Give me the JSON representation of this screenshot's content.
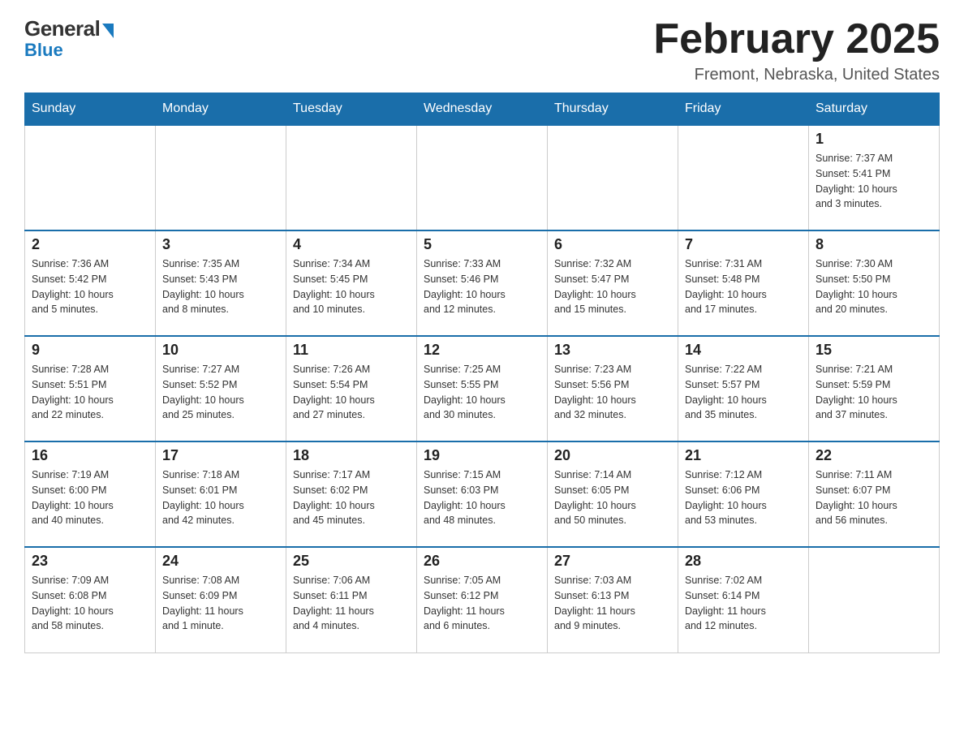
{
  "logo": {
    "general": "General",
    "blue": "Blue"
  },
  "title": "February 2025",
  "location": "Fremont, Nebraska, United States",
  "days_of_week": [
    "Sunday",
    "Monday",
    "Tuesday",
    "Wednesday",
    "Thursday",
    "Friday",
    "Saturday"
  ],
  "weeks": [
    [
      {
        "day": "",
        "info": ""
      },
      {
        "day": "",
        "info": ""
      },
      {
        "day": "",
        "info": ""
      },
      {
        "day": "",
        "info": ""
      },
      {
        "day": "",
        "info": ""
      },
      {
        "day": "",
        "info": ""
      },
      {
        "day": "1",
        "info": "Sunrise: 7:37 AM\nSunset: 5:41 PM\nDaylight: 10 hours\nand 3 minutes."
      }
    ],
    [
      {
        "day": "2",
        "info": "Sunrise: 7:36 AM\nSunset: 5:42 PM\nDaylight: 10 hours\nand 5 minutes."
      },
      {
        "day": "3",
        "info": "Sunrise: 7:35 AM\nSunset: 5:43 PM\nDaylight: 10 hours\nand 8 minutes."
      },
      {
        "day": "4",
        "info": "Sunrise: 7:34 AM\nSunset: 5:45 PM\nDaylight: 10 hours\nand 10 minutes."
      },
      {
        "day": "5",
        "info": "Sunrise: 7:33 AM\nSunset: 5:46 PM\nDaylight: 10 hours\nand 12 minutes."
      },
      {
        "day": "6",
        "info": "Sunrise: 7:32 AM\nSunset: 5:47 PM\nDaylight: 10 hours\nand 15 minutes."
      },
      {
        "day": "7",
        "info": "Sunrise: 7:31 AM\nSunset: 5:48 PM\nDaylight: 10 hours\nand 17 minutes."
      },
      {
        "day": "8",
        "info": "Sunrise: 7:30 AM\nSunset: 5:50 PM\nDaylight: 10 hours\nand 20 minutes."
      }
    ],
    [
      {
        "day": "9",
        "info": "Sunrise: 7:28 AM\nSunset: 5:51 PM\nDaylight: 10 hours\nand 22 minutes."
      },
      {
        "day": "10",
        "info": "Sunrise: 7:27 AM\nSunset: 5:52 PM\nDaylight: 10 hours\nand 25 minutes."
      },
      {
        "day": "11",
        "info": "Sunrise: 7:26 AM\nSunset: 5:54 PM\nDaylight: 10 hours\nand 27 minutes."
      },
      {
        "day": "12",
        "info": "Sunrise: 7:25 AM\nSunset: 5:55 PM\nDaylight: 10 hours\nand 30 minutes."
      },
      {
        "day": "13",
        "info": "Sunrise: 7:23 AM\nSunset: 5:56 PM\nDaylight: 10 hours\nand 32 minutes."
      },
      {
        "day": "14",
        "info": "Sunrise: 7:22 AM\nSunset: 5:57 PM\nDaylight: 10 hours\nand 35 minutes."
      },
      {
        "day": "15",
        "info": "Sunrise: 7:21 AM\nSunset: 5:59 PM\nDaylight: 10 hours\nand 37 minutes."
      }
    ],
    [
      {
        "day": "16",
        "info": "Sunrise: 7:19 AM\nSunset: 6:00 PM\nDaylight: 10 hours\nand 40 minutes."
      },
      {
        "day": "17",
        "info": "Sunrise: 7:18 AM\nSunset: 6:01 PM\nDaylight: 10 hours\nand 42 minutes."
      },
      {
        "day": "18",
        "info": "Sunrise: 7:17 AM\nSunset: 6:02 PM\nDaylight: 10 hours\nand 45 minutes."
      },
      {
        "day": "19",
        "info": "Sunrise: 7:15 AM\nSunset: 6:03 PM\nDaylight: 10 hours\nand 48 minutes."
      },
      {
        "day": "20",
        "info": "Sunrise: 7:14 AM\nSunset: 6:05 PM\nDaylight: 10 hours\nand 50 minutes."
      },
      {
        "day": "21",
        "info": "Sunrise: 7:12 AM\nSunset: 6:06 PM\nDaylight: 10 hours\nand 53 minutes."
      },
      {
        "day": "22",
        "info": "Sunrise: 7:11 AM\nSunset: 6:07 PM\nDaylight: 10 hours\nand 56 minutes."
      }
    ],
    [
      {
        "day": "23",
        "info": "Sunrise: 7:09 AM\nSunset: 6:08 PM\nDaylight: 10 hours\nand 58 minutes."
      },
      {
        "day": "24",
        "info": "Sunrise: 7:08 AM\nSunset: 6:09 PM\nDaylight: 11 hours\nand 1 minute."
      },
      {
        "day": "25",
        "info": "Sunrise: 7:06 AM\nSunset: 6:11 PM\nDaylight: 11 hours\nand 4 minutes."
      },
      {
        "day": "26",
        "info": "Sunrise: 7:05 AM\nSunset: 6:12 PM\nDaylight: 11 hours\nand 6 minutes."
      },
      {
        "day": "27",
        "info": "Sunrise: 7:03 AM\nSunset: 6:13 PM\nDaylight: 11 hours\nand 9 minutes."
      },
      {
        "day": "28",
        "info": "Sunrise: 7:02 AM\nSunset: 6:14 PM\nDaylight: 11 hours\nand 12 minutes."
      },
      {
        "day": "",
        "info": ""
      }
    ]
  ]
}
